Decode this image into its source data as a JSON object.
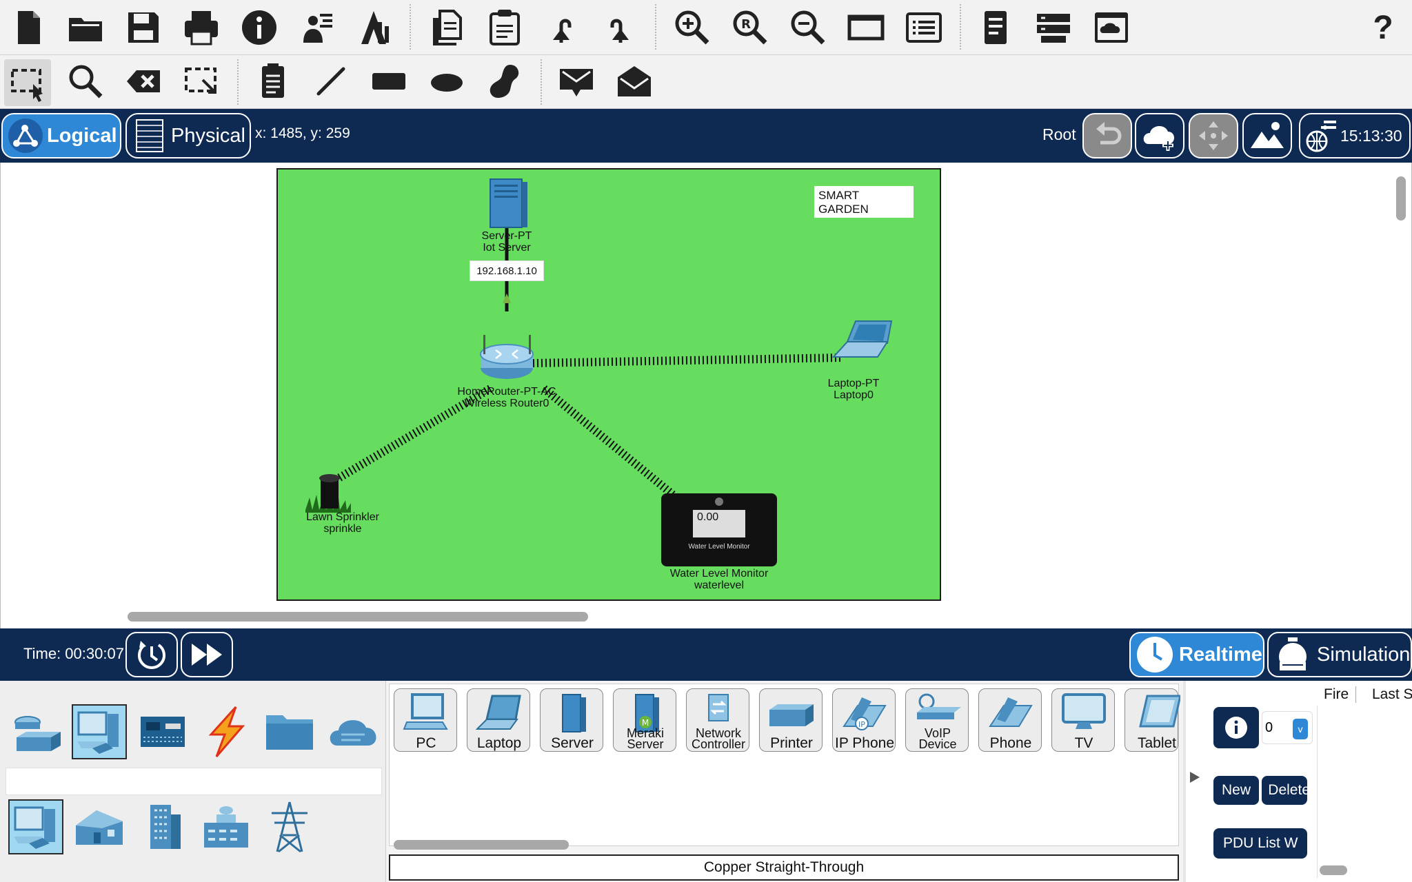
{
  "toolbar_top": {
    "buttons": [
      "new-file",
      "open-folder",
      "save",
      "print",
      "info",
      "activity-wizard",
      "custom-device",
      "copy",
      "paste",
      "undo",
      "redo",
      "zoom-in",
      "zoom-reset",
      "zoom-out",
      "drawing-palette",
      "custom-devices-dialog",
      "view-list",
      "network-info",
      "cluster",
      "cloud-device"
    ],
    "help_label": "?"
  },
  "toolbar_second": {
    "buttons": [
      "select",
      "inspect",
      "delete",
      "resize-shape",
      "place-note",
      "draw-line",
      "draw-rectangle",
      "draw-ellipse",
      "draw-freeform",
      "add-simple-pdu",
      "add-complex-pdu"
    ]
  },
  "nav": {
    "logical_label": "Logical",
    "physical_label": "Physical",
    "coordinates": "x: 1485, y: 259",
    "root_label": "Root",
    "clock": "15:13:30"
  },
  "workspace": {
    "note_text": "SMART GARDEN",
    "ip_tag": "192.168.1.10",
    "devices": [
      {
        "type": "Server-PT",
        "name": "Iot Server"
      },
      {
        "type": "HomeRouter-PT-AC",
        "name": "Wireless Router0"
      },
      {
        "type": "Laptop-PT",
        "name": "Laptop0"
      },
      {
        "type": "Lawn Sprinkler",
        "name": "sprinkle"
      },
      {
        "type": "Water Level Monitor",
        "name": "waterlevel"
      }
    ],
    "water_level_value": "0.00",
    "water_level_caption": "Water Level Monitor"
  },
  "timebar": {
    "time_label": "Time: 00:30:07",
    "realtime_label": "Realtime",
    "simulation_label": "Simulation"
  },
  "device_panel": {
    "devices": [
      "PC",
      "Laptop",
      "Server",
      "Meraki Server",
      "Network Controller",
      "Printer",
      "IP Phone",
      "VoIP Device",
      "Phone",
      "TV",
      "Tablet"
    ],
    "cable_label": "Copper Straight-Through"
  },
  "pdu": {
    "new_label": "New",
    "delete_label": "Delete",
    "pdu_list_label": "PDU List W",
    "select_value": "0",
    "col_fire": "Fire",
    "col_last_status": "Last Sta"
  },
  "colors": {
    "navy": "#0e2a52",
    "accent_blue": "#2f88d6",
    "garden_green": "#66dd5f"
  }
}
